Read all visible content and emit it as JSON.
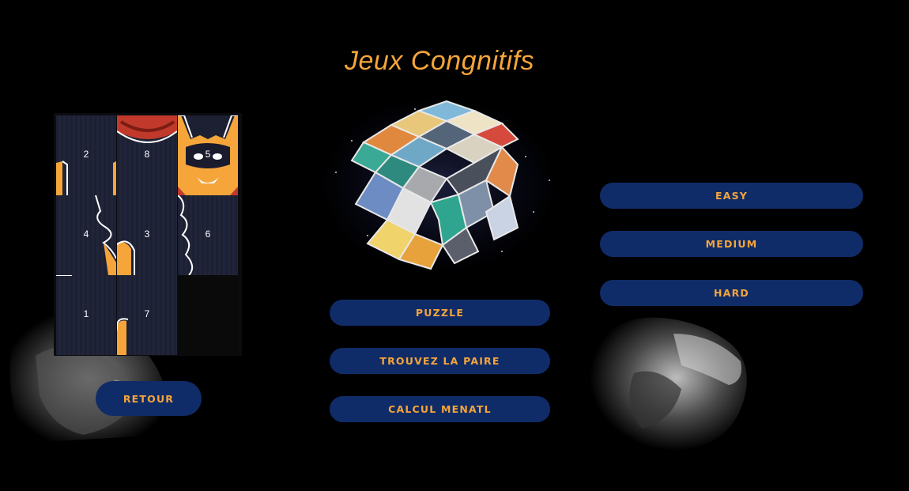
{
  "page": {
    "title": "Jeux Congnitifs"
  },
  "puzzle": {
    "tiles": [
      {
        "label": "2"
      },
      {
        "label": "8"
      },
      {
        "label": "5"
      },
      {
        "label": "4"
      },
      {
        "label": "3"
      },
      {
        "label": "6"
      },
      {
        "label": "1"
      },
      {
        "label": "7"
      },
      {
        "label": ""
      }
    ]
  },
  "buttons": {
    "retour": "RETOUR",
    "puzzle": "PUZZLE",
    "paire": "TROUVEZ LA PAIRE",
    "calcul": "CALCUL MENATL",
    "easy": "EASY",
    "medium": "MEDIUM",
    "hard": "HARD"
  },
  "colors": {
    "accent": "#f5a53a",
    "button": "#102c68",
    "background": "#000000"
  }
}
